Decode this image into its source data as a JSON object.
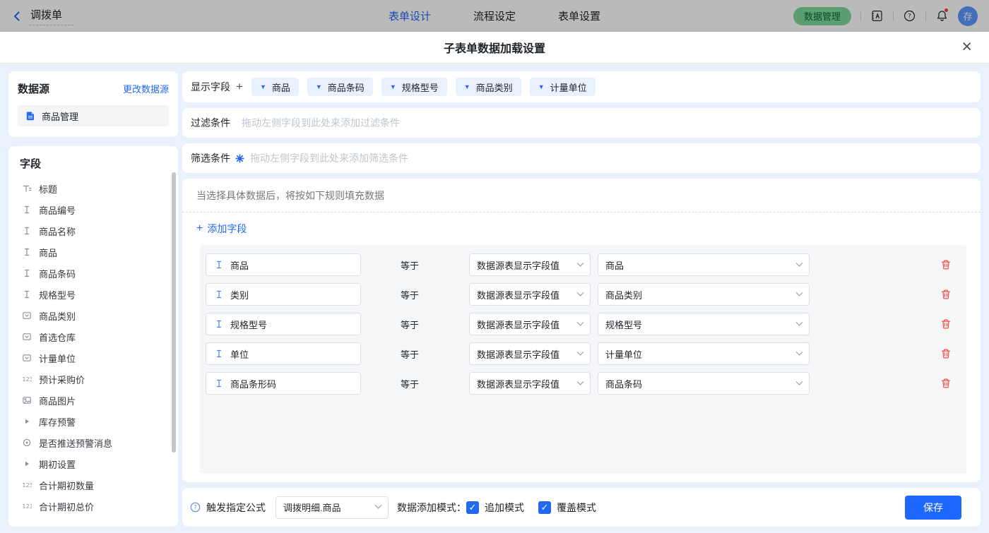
{
  "topbar": {
    "back_label": "调拨单",
    "tabs": [
      {
        "label": "表单设计",
        "active": true
      },
      {
        "label": "流程设定",
        "active": false
      },
      {
        "label": "表单设置",
        "active": false
      }
    ],
    "data_manage_button": "数据管理",
    "avatar_text": "存"
  },
  "modal": {
    "title": "子表单数据加载设置",
    "datasource": {
      "title": "数据源",
      "change_link": "更改数据源",
      "items": [
        {
          "icon": "document",
          "label": "商品管理"
        }
      ]
    },
    "fields_panel": {
      "title": "字段",
      "items": [
        {
          "icon": "title",
          "label": "标题"
        },
        {
          "icon": "text",
          "label": "商品编号"
        },
        {
          "icon": "text",
          "label": "商品名称"
        },
        {
          "icon": "text",
          "label": "商品"
        },
        {
          "icon": "text",
          "label": "商品条码"
        },
        {
          "icon": "text",
          "label": "规格型号"
        },
        {
          "icon": "select",
          "label": "商品类别"
        },
        {
          "icon": "select",
          "label": "首选仓库"
        },
        {
          "icon": "select",
          "label": "计量单位"
        },
        {
          "icon": "number",
          "label": "预计采购价"
        },
        {
          "icon": "image",
          "label": "商品图片"
        },
        {
          "icon": "group",
          "label": "库存预警"
        },
        {
          "icon": "radio",
          "label": "是否推送预警消息"
        },
        {
          "icon": "group",
          "label": "期初设置"
        },
        {
          "icon": "number",
          "label": "合计期初数量"
        },
        {
          "icon": "number",
          "label": "合计期初总价"
        }
      ]
    },
    "display_fields": {
      "label": "显示字段",
      "add_icon": "+",
      "tags": [
        "商品",
        "商品条码",
        "规格型号",
        "商品类别",
        "计量单位"
      ]
    },
    "filter": {
      "label": "过滤条件",
      "placeholder": "拖动左侧字段到此处来添加过滤条件"
    },
    "screen": {
      "label": "筛选条件",
      "placeholder": "拖动左侧字段到此处来添加筛选条件"
    },
    "rules": {
      "hint": "当选择具体数据后，将按如下规则填充数据",
      "add_icon": "+",
      "add_label": "添加字段",
      "rows": [
        {
          "field": "商品",
          "op": "等于",
          "source": "数据源表显示字段值",
          "value": "商品"
        },
        {
          "field": "类别",
          "op": "等于",
          "source": "数据源表显示字段值",
          "value": "商品类别"
        },
        {
          "field": "规格型号",
          "op": "等于",
          "source": "数据源表显示字段值",
          "value": "规格型号"
        },
        {
          "field": "单位",
          "op": "等于",
          "source": "数据源表显示字段值",
          "value": "计量单位"
        },
        {
          "field": "商品条形码",
          "op": "等于",
          "source": "数据源表显示字段值",
          "value": "商品条码"
        }
      ]
    },
    "footer": {
      "formula_label": "触发指定公式",
      "formula_value": "调拨明细.商品",
      "mode_label": "数据添加模式：",
      "modes": [
        {
          "label": "追加模式",
          "checked": true
        },
        {
          "label": "覆盖模式",
          "checked": true
        }
      ],
      "save_label": "保存"
    }
  },
  "colors": {
    "accent": "#2468f2",
    "danger": "#f54a45",
    "body-bg": "#e9f1fc",
    "panel-bg": "#f5f6f8",
    "tag-bg": "#e8f1fd",
    "border": "#dcdfe5",
    "placeholder": "#bfc4cd",
    "green-bg": "#7ed79d",
    "green-text": "#0c6b38",
    "avatar-bg": "#5b97ff",
    "save-bg": "#1e68ff"
  }
}
